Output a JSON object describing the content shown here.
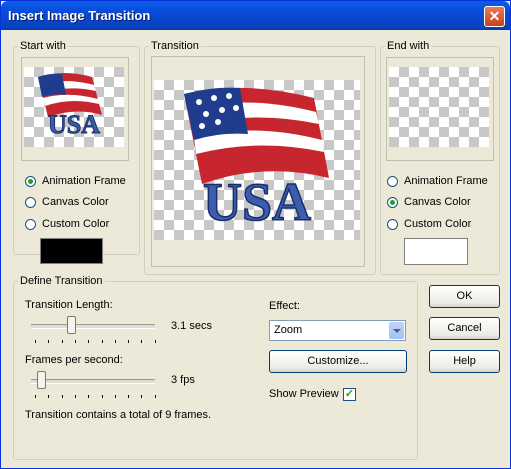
{
  "window": {
    "title": "Insert Image Transition",
    "close_glyph": "✕"
  },
  "start_with": {
    "legend": "Start with",
    "options": [
      {
        "label": "Animation Frame",
        "selected": true
      },
      {
        "label": "Canvas Color",
        "selected": false
      },
      {
        "label": "Custom Color",
        "selected": false
      }
    ],
    "custom_color": "#000000"
  },
  "transition": {
    "legend": "Transition"
  },
  "end_with": {
    "legend": "End with",
    "options": [
      {
        "label": "Animation Frame",
        "selected": false
      },
      {
        "label": "Canvas Color",
        "selected": true
      },
      {
        "label": "Custom Color",
        "selected": false
      }
    ],
    "custom_color": "#ffffff"
  },
  "define": {
    "legend": "Define Transition",
    "length_label": "Transition Length:",
    "length_value": "3.1 secs",
    "fps_label": "Frames per second:",
    "fps_value": "3 fps",
    "summary": "Transition contains a total of 9 frames.",
    "effect_label": "Effect:",
    "effect_value": "Zoom",
    "customize_label": "Customize...",
    "show_preview_label": "Show Preview",
    "show_preview_checked": true
  },
  "buttons": {
    "ok": "OK",
    "cancel": "Cancel",
    "help": "Help"
  },
  "preview_image_text": "USA"
}
